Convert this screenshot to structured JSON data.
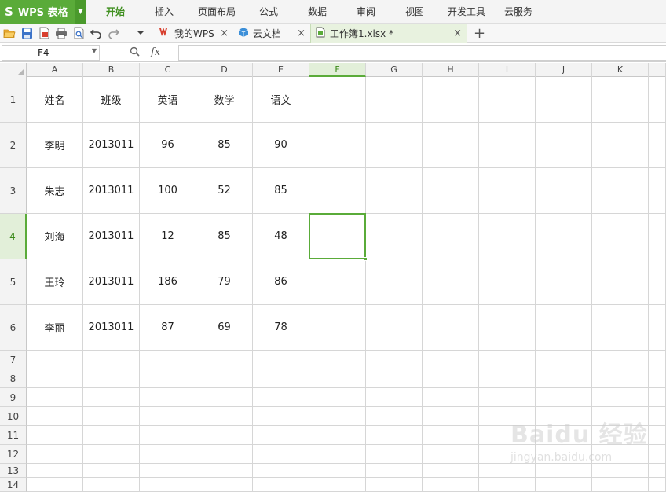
{
  "app": {
    "name": "WPS 表格",
    "logo": "S"
  },
  "menu": [
    "开始",
    "插入",
    "页面布局",
    "公式",
    "数据",
    "审阅",
    "视图",
    "开发工具",
    "云服务"
  ],
  "menu_active_index": 0,
  "tabs": [
    {
      "label": "我的WPS",
      "icon": "wps-icon"
    },
    {
      "label": "云文档",
      "icon": "cloud-doc-icon"
    },
    {
      "label": "工作簿1.xlsx *",
      "icon": "sheet-file-icon",
      "active": true
    }
  ],
  "formula_bar": {
    "name_box": "F4",
    "fx_label": "fx",
    "formula": ""
  },
  "columns": [
    "A",
    "B",
    "C",
    "D",
    "E",
    "F",
    "G",
    "H",
    "I",
    "J",
    "K"
  ],
  "selected_column": "F",
  "selected_row": 4,
  "rows": [
    {
      "n": 1,
      "cells": [
        "姓名",
        "班级",
        "英语",
        "数学",
        "语文"
      ]
    },
    {
      "n": 2,
      "cells": [
        "李明",
        "2013011",
        "96",
        "85",
        "90"
      ]
    },
    {
      "n": 3,
      "cells": [
        "朱志",
        "2013011",
        "100",
        "52",
        "85"
      ]
    },
    {
      "n": 4,
      "cells": [
        "刘海",
        "2013011",
        "12",
        "85",
        "48"
      ]
    },
    {
      "n": 5,
      "cells": [
        "王玲",
        "2013011",
        "186",
        "79",
        "86"
      ]
    },
    {
      "n": 6,
      "cells": [
        "李丽",
        "2013011",
        "87",
        "69",
        "78"
      ]
    },
    {
      "n": 7,
      "cells": []
    },
    {
      "n": 8,
      "cells": []
    },
    {
      "n": 9,
      "cells": []
    },
    {
      "n": 10,
      "cells": []
    },
    {
      "n": 11,
      "cells": []
    },
    {
      "n": 12,
      "cells": []
    },
    {
      "n": 13,
      "cells": []
    },
    {
      "n": 14,
      "cells": []
    }
  ],
  "watermark": {
    "main": "Baidu 经验",
    "sub": "jingyan.baidu.com"
  },
  "colors": {
    "accent": "#5aab39",
    "header_bg": "#f3f3f3",
    "selected_header_bg": "#e2efd9"
  }
}
